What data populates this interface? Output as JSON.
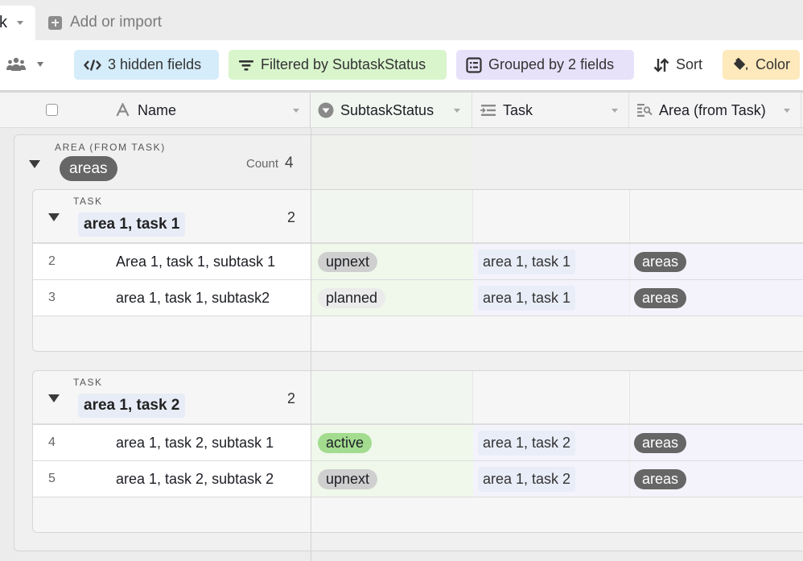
{
  "tabs": {
    "active_tab_label": "k",
    "add_import_label": "Add or import"
  },
  "toolbar": {
    "hidden_fields_label": "3 hidden fields",
    "filter_label": "Filtered by SubtaskStatus",
    "group_label": "Grouped by 2 fields",
    "sort_label": "Sort",
    "color_label": "Color"
  },
  "columns": {
    "name": "Name",
    "status": "SubtaskStatus",
    "task": "Task",
    "area": "Area (from Task)"
  },
  "outer_group": {
    "field_label": "AREA (FROM TASK)",
    "value": "areas",
    "count_label": "Count",
    "count": "4"
  },
  "groups": [
    {
      "field_label": "TASK",
      "value": "area 1, task 1",
      "count": "2",
      "rows": [
        {
          "num": "2",
          "name": "Area 1, task 1, subtask 1",
          "status": "upnext",
          "task": "area 1, task 1",
          "area": "areas"
        },
        {
          "num": "3",
          "name": "area 1, task 1, subtask2",
          "status": "planned",
          "task": "area 1, task 1",
          "area": "areas"
        }
      ]
    },
    {
      "field_label": "TASK",
      "value": "area 1, task 2",
      "count": "2",
      "rows": [
        {
          "num": "4",
          "name": "area 1, task 2, subtask 1",
          "status": "active",
          "task": "area 1, task 2",
          "area": "areas"
        },
        {
          "num": "5",
          "name": "area 1, task 2, subtask 2",
          "status": "upnext",
          "task": "area 1, task 2",
          "area": "areas"
        }
      ]
    }
  ],
  "status_colors": {
    "upnext": "#cfcfcf",
    "planned": "#ebebeb",
    "active": "#a3dc8f"
  }
}
